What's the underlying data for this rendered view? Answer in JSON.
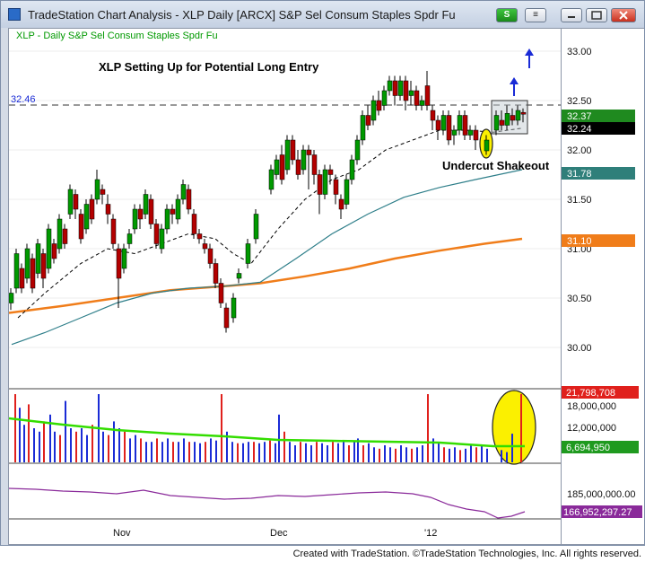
{
  "window": {
    "title": "TradeStation Chart Analysis - XLP Daily [ARCX] S&P Sel Consum Staples Spdr Fu",
    "symbol_button": "S",
    "menu_button": "≡",
    "minimize_icon": "minimize-icon",
    "restore_icon": "restore-icon",
    "close_icon": "close-icon"
  },
  "chart": {
    "legend": "XLP - Daily  S&P Sel Consum Staples Spdr Fu",
    "headline": "XLP Setting Up for Potential Long Entry",
    "annotation": "Undercut Shakeout",
    "resistance_label": "32.46",
    "price_ticks": [
      "33.00",
      "32.50",
      "32.00",
      "31.50",
      "31.00",
      "30.50",
      "30.00"
    ],
    "volume_ticks": [
      "18,000,000",
      "12,000,000"
    ],
    "osc_ticks": [
      "185,000,000.00"
    ],
    "date_labels": [
      "Nov",
      "Dec",
      "'12"
    ],
    "badges": {
      "close": "32.37",
      "prev": "32.24",
      "ma50": "31.78",
      "ma200": "31.10",
      "volume": "21,798,708",
      "volume_avg": "6,694,950",
      "oscillator": "166,952,297.27"
    },
    "colors": {
      "up": "#009900",
      "down": "#b30000",
      "ma10": "#000000",
      "ma50": "#2f7f8a",
      "ma200": "#f07d1a",
      "vol_up": "#1a2bd6",
      "vol_down": "#e0201c",
      "vol_avg": "#33dd00",
      "oscillator": "#8a2a9a",
      "highlight": "#fbf000"
    }
  },
  "footer": {
    "credit": "Created with TradeStation. ©TradeStation Technologies, Inc. All rights reserved."
  }
}
